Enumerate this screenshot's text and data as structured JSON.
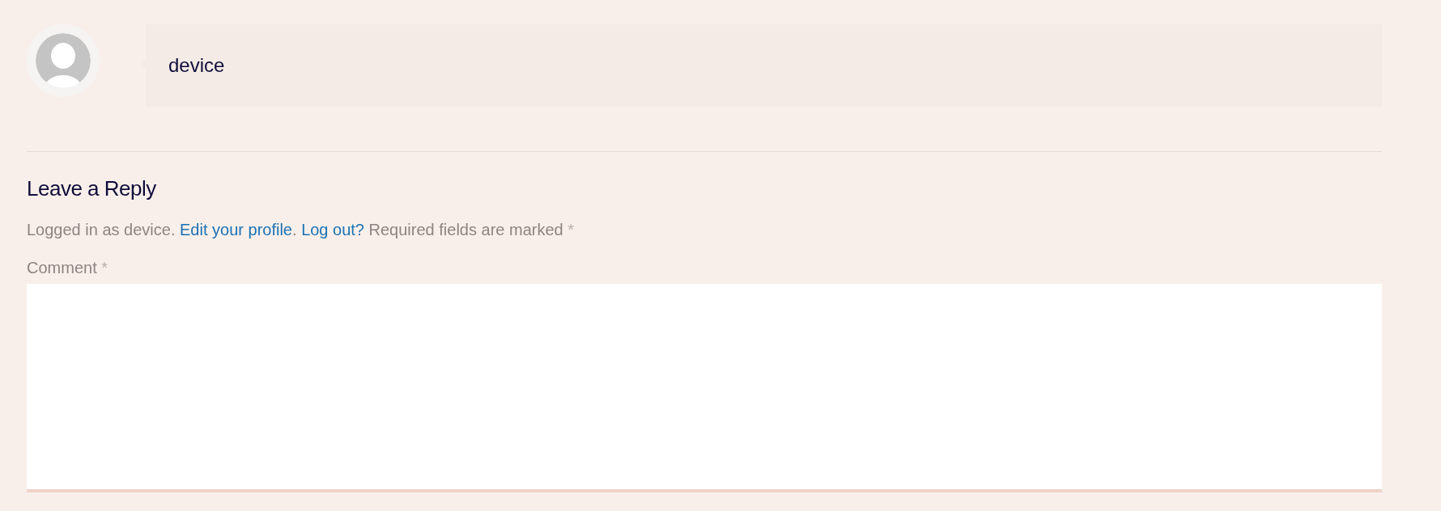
{
  "comment": {
    "author": "device"
  },
  "reply": {
    "title": "Leave a Reply",
    "logged_in": {
      "prefix": "Logged in as device.",
      "edit_link": "Edit your profile",
      "separator": ".",
      "logout_link": "Log out?",
      "suffix": "Required fields are marked",
      "required_mark": "*"
    },
    "comment_field": {
      "label": "Comment",
      "required_mark": "*"
    }
  }
}
